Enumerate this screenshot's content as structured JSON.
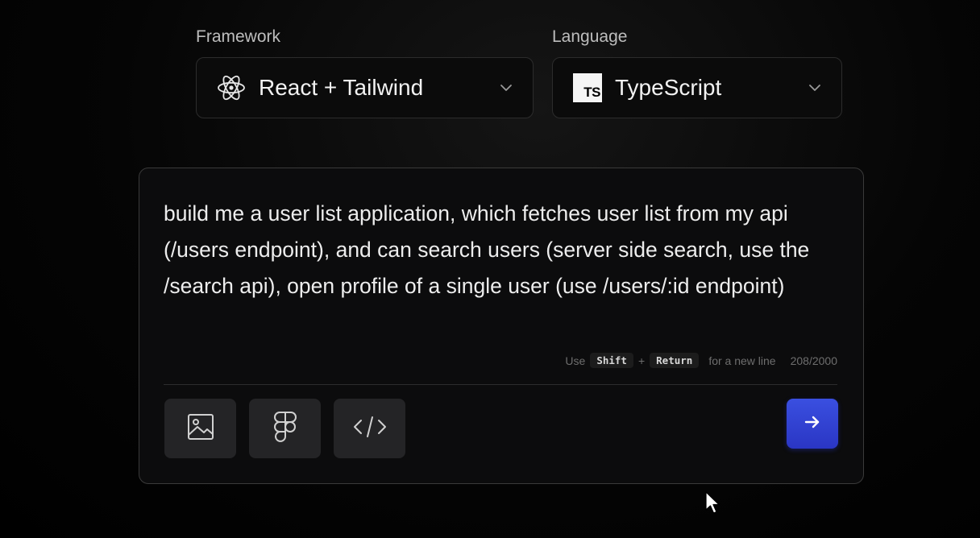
{
  "framework": {
    "label": "Framework",
    "selected": "React + Tailwind",
    "icon": "react-atom-icon"
  },
  "language": {
    "label": "Language",
    "selected": "TypeScript",
    "icon_text": "TS"
  },
  "composer": {
    "prompt": "build me a user list application, which fetches user list from my api (/users endpoint), and can search users (server side search, use the /search api), open profile of a single user (use /users/:id endpoint)",
    "hint_prefix": "Use",
    "hint_key1": "Shift",
    "hint_plus": "+",
    "hint_key2": "Return",
    "hint_suffix": "for a new line",
    "char_count": "208/2000",
    "tools": [
      {
        "icon": "image-icon"
      },
      {
        "icon": "figma-icon"
      },
      {
        "icon": "code-icon"
      }
    ],
    "send_icon": "arrow-right-icon"
  },
  "colors": {
    "accent": "#3a4fe0",
    "background": "#000000",
    "panel": "#0c0c0d",
    "tool_button": "#242426"
  }
}
